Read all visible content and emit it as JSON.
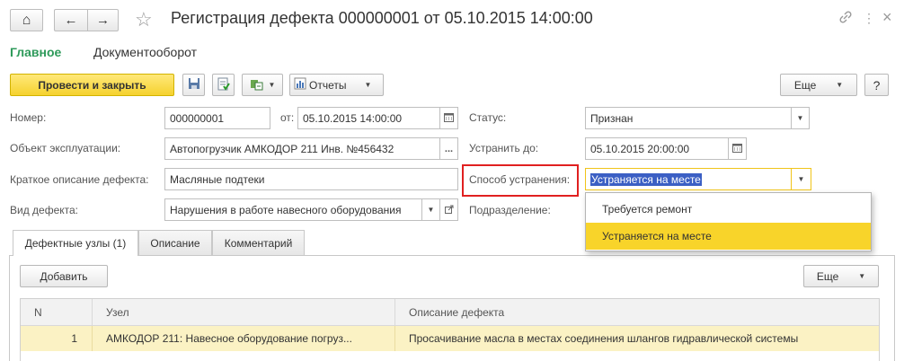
{
  "window": {
    "title": "Регистрация дефекта 000000001 от 05.10.2015 14:00:00",
    "home_icon": "⌂",
    "back_icon": "←",
    "forward_icon": "→",
    "star_icon": "☆",
    "link_icon": "🔗",
    "more_icon": "⋮",
    "close_icon": "×"
  },
  "sections": [
    {
      "label": "Главное",
      "active": true
    },
    {
      "label": "Документооборот",
      "active": false
    }
  ],
  "toolbar": {
    "post_and_close": "Провести и закрыть",
    "reports": "Отчеты",
    "more": "Еще",
    "help": "?"
  },
  "form": {
    "number_label": "Номер:",
    "number_value": "000000001",
    "date_from_label": "от:",
    "date_value": "05.10.2015 14:00:00",
    "status_label": "Статус:",
    "status_value": "Признан",
    "object_label": "Объект эксплуатации:",
    "object_value": "Автопогрузчик АМКОДОР 211 Инв. №456432",
    "fix_by_label": "Устранить до:",
    "fix_by_value": "05.10.2015 20:00:00",
    "short_desc_label": "Краткое описание дефекта:",
    "short_desc_value": "Масляные подтеки",
    "method_label": "Способ устранения:",
    "method_value": "Устраняется на месте",
    "defect_type_label": "Вид дефекта:",
    "defect_type_value": "Нарушения в работе навесного оборудования",
    "department_label": "Подразделение:",
    "ellipsis": "..."
  },
  "dropdown": {
    "options": [
      "Требуется ремонт",
      "Устраняется на месте"
    ],
    "selected_index": 1
  },
  "tabs": [
    {
      "label": "Дефектные узлы (1)",
      "active": true
    },
    {
      "label": "Описание",
      "active": false
    },
    {
      "label": "Комментарий",
      "active": false
    }
  ],
  "table_toolbar": {
    "add": "Добавить",
    "more": "Еще"
  },
  "table": {
    "columns": [
      "N",
      "Узел",
      "Описание дефекта"
    ],
    "rows": [
      [
        "1",
        "АМКОДОР 211: Навесное оборудование погруз...",
        "Просачивание масла в местах соединения шлангов гидравлической системы"
      ]
    ]
  },
  "colors": {
    "accent_green": "#2e9a5a",
    "primary_yellow": "#f5d22e",
    "highlight_red": "#e02020",
    "selection_blue": "#3b5fc4",
    "row_highlight": "#fbf2c4"
  }
}
